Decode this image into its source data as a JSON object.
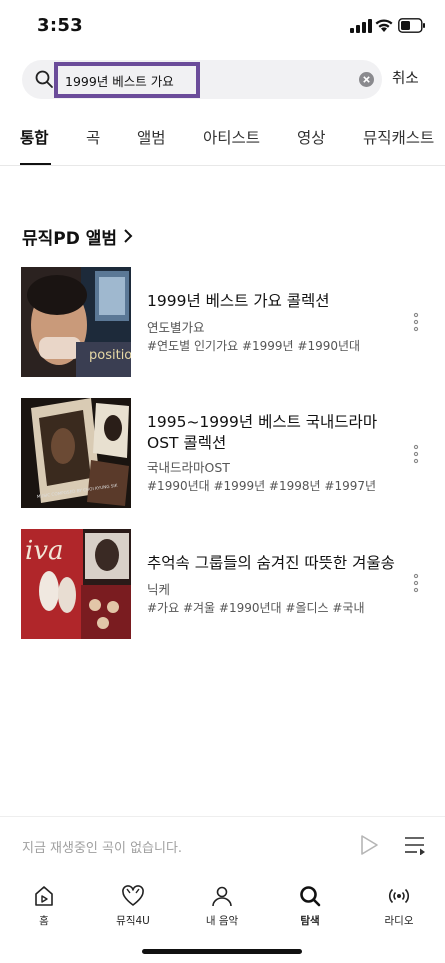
{
  "status_bar": {
    "time": "3:53"
  },
  "search": {
    "query": "1999년 베스트 가요",
    "cancel_label": "취소"
  },
  "tabs": [
    {
      "label": "통합",
      "active": true
    },
    {
      "label": "곡",
      "active": false
    },
    {
      "label": "앨범",
      "active": false
    },
    {
      "label": "아티스트",
      "active": false
    },
    {
      "label": "영상",
      "active": false
    },
    {
      "label": "뮤직캐스트",
      "active": false
    }
  ],
  "section": {
    "title": "뮤직PD 앨범"
  },
  "albums": [
    {
      "title": "1999년 베스트 가요 콜렉션",
      "artist": "연도별가요",
      "tags": "#연도별 인기가요  #1999년  #1990년대",
      "cover_label": "position"
    },
    {
      "title": "1995~1999년 베스트 국내드라마 OST 콜렉션",
      "artist": "국내드라마OST",
      "tags": "#1990년대  #1999년  #1998년  #1997년",
      "cover_label": "MUSIC COMPOSED BY CHOI KYUNG SIK"
    },
    {
      "title": "추억속 그룹들의 숨겨진 따뜻한 겨울송",
      "artist": "닉케",
      "tags": "#가요  #겨울  #1990년대  #올디스  #국내",
      "cover_label": "iva"
    }
  ],
  "mini_player": {
    "status_text": "지금 재생중인 곡이 없습니다."
  },
  "bottom_nav": [
    {
      "label": "홈",
      "icon": "home-icon",
      "active": false
    },
    {
      "label": "뮤직4U",
      "icon": "heart-icon",
      "active": false
    },
    {
      "label": "내 음악",
      "icon": "person-icon",
      "active": false
    },
    {
      "label": "탐색",
      "icon": "search-icon",
      "active": true
    },
    {
      "label": "라디오",
      "icon": "radio-icon",
      "active": false
    }
  ],
  "colors": {
    "search_highlight": "#6b4c9a",
    "search_bg": "#f1f1f3",
    "placeholder_gray": "#a0a0a0"
  }
}
